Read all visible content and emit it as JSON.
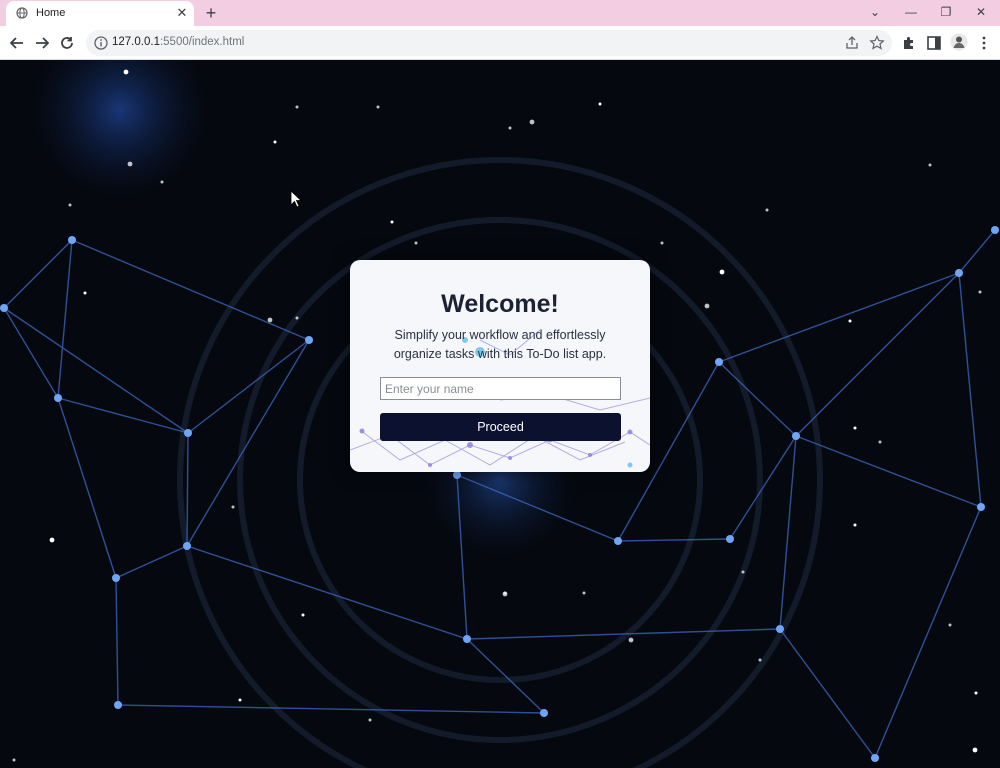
{
  "browser": {
    "tab_title": "Home",
    "tab_close_glyph": "✕",
    "new_tab_glyph": "+",
    "address_host": "127.0.0.1",
    "address_rest": ":5500/index.html",
    "window_controls": [
      "⌄",
      "—",
      "❐",
      "✕"
    ],
    "icons": {
      "favicon": "globe-icon",
      "info": "info-icon",
      "share": "share-icon",
      "bookmark": "star-icon",
      "extensions": "puzzle-icon",
      "sidepanel": "side-panel-icon",
      "profile": "avatar-icon",
      "menu": "kebab-menu-icon"
    }
  },
  "welcome_card": {
    "title": "Welcome!",
    "description": "Simplify your workflow and effortlessly organize tasks with this To-Do list app.",
    "input_placeholder": "Enter your name",
    "button_label": "Proceed"
  },
  "colors": {
    "tabbar_bg": "#f3cde2",
    "page_bg": "#05080f",
    "network_line": "#3a63b8",
    "network_node": "#6ea6f5",
    "button_bg": "#0d1130",
    "card_bg": "#f6f7fb"
  }
}
